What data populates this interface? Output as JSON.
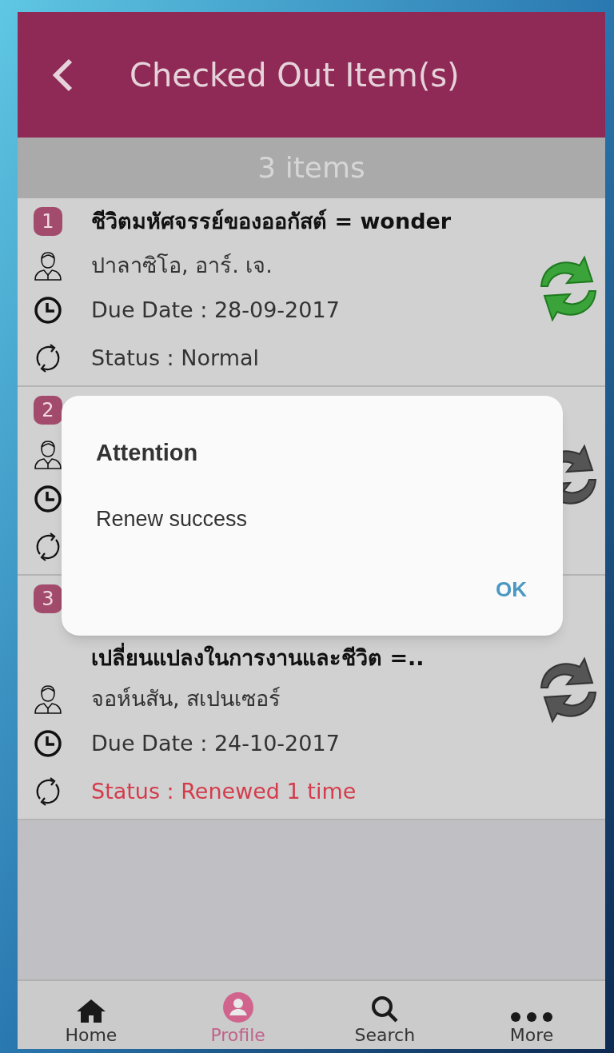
{
  "header": {
    "title": "Checked Out Item(s)"
  },
  "count_bar": {
    "text": "3 items"
  },
  "items": [
    {
      "number": "1",
      "title": "ชีวิตมหัศจรรย์ของออกัสต์ = wonder",
      "author": "ปาลาซิโอ, อาร์. เจ.",
      "due": "Due Date : 28-09-2017",
      "status": "Status : Normal",
      "kind": "normal",
      "renew_enabled": true
    },
    {
      "number": "2",
      "renew_enabled": false
    },
    {
      "number": "3",
      "title_line_2": "เปลี่ยนแปลงในการงานและชีวิต =..",
      "author": "จอห์นสัน, สเปนเซอร์",
      "due": "Due Date : 24-10-2017",
      "status": "Status : Renewed 1 time",
      "kind": "renewed",
      "renew_enabled": false
    }
  ],
  "dialog": {
    "title": "Attention",
    "message": "Renew success",
    "button": "OK"
  },
  "nav": [
    {
      "label": "Home",
      "kind": "home",
      "selected": false
    },
    {
      "label": "Profile",
      "kind": "profile",
      "selected": true
    },
    {
      "label": "Search",
      "kind": "search",
      "selected": false
    },
    {
      "label": "More",
      "kind": "more",
      "selected": false
    }
  ]
}
